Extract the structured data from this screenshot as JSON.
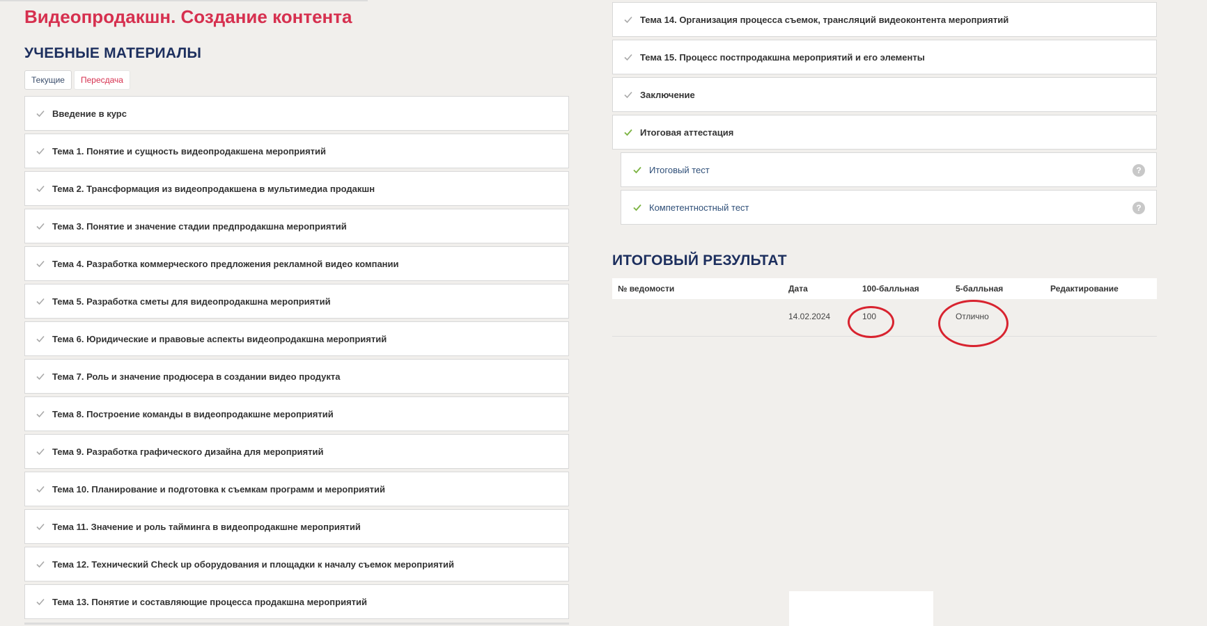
{
  "course": {
    "title": "Видеопродакшн. Создание контента"
  },
  "materials": {
    "heading": "УЧЕБНЫЕ МАТЕРИАЛЫ",
    "tabs": [
      "Текущие",
      "Пересдача"
    ],
    "topics": [
      "Введение в курс",
      "Тема 1. Понятие и сущность видеопродакшена мероприятий",
      "Тема 2. Трансформация из видеопродакшена в мультимедиа продакшн",
      "Тема 3. Понятие и значение стадии предпродакшна мероприятий",
      "Тема 4. Разработка коммерческого предложения рекламной видео компании",
      "Тема 5. Разработка сметы для видеопродакшна мероприятий",
      "Тема 6. Юридические и правовые аспекты видеопродакшна мероприятий",
      "Тема 7. Роль и значение продюсера в создании видео продукта",
      "Тема 8. Построение команды в видеопродакшне мероприятий",
      "Тема 9. Разработка графического дизайна для мероприятий",
      "Тема 10. Планирование и подготовка к съемкам программ и мероприятий",
      "Тема 11. Значение и роль тайминга в видеопродакшне мероприятий",
      "Тема 12. Технический Check up оборудования и площадки к началу съемок мероприятий",
      "Тема 13. Понятие и составляющие процесса продакшна мероприятий"
    ],
    "topics_right": [
      "Тема 14. Организация процесса съемок, трансляций видеоконтента мероприятий",
      "Тема 15. Процесс постпродакшна мероприятий и его элементы",
      "Заключение",
      "Итоговая аттестация"
    ],
    "subtopics": [
      {
        "label": "Итоговый тест",
        "help": "?"
      },
      {
        "label": "Компетентностный тест",
        "help": "?"
      }
    ]
  },
  "result": {
    "heading": "ИТОГОВЫЙ РЕЗУЛЬТАТ",
    "columns": [
      "№ ведомости",
      "Дата",
      "100-балльная",
      "5-балльная",
      "Редактирование"
    ],
    "rows": [
      {
        "number": "",
        "date": "14.02.2024",
        "score100": "100",
        "score5": "Отлично",
        "edit": ""
      }
    ]
  },
  "colors": {
    "background": "#f1efec",
    "title_red": "#d6304f",
    "heading_navy": "#1d2f5e",
    "check_gray": "#a9a9a9",
    "check_green": "#7cb342",
    "annotation_red": "#d8232f"
  }
}
